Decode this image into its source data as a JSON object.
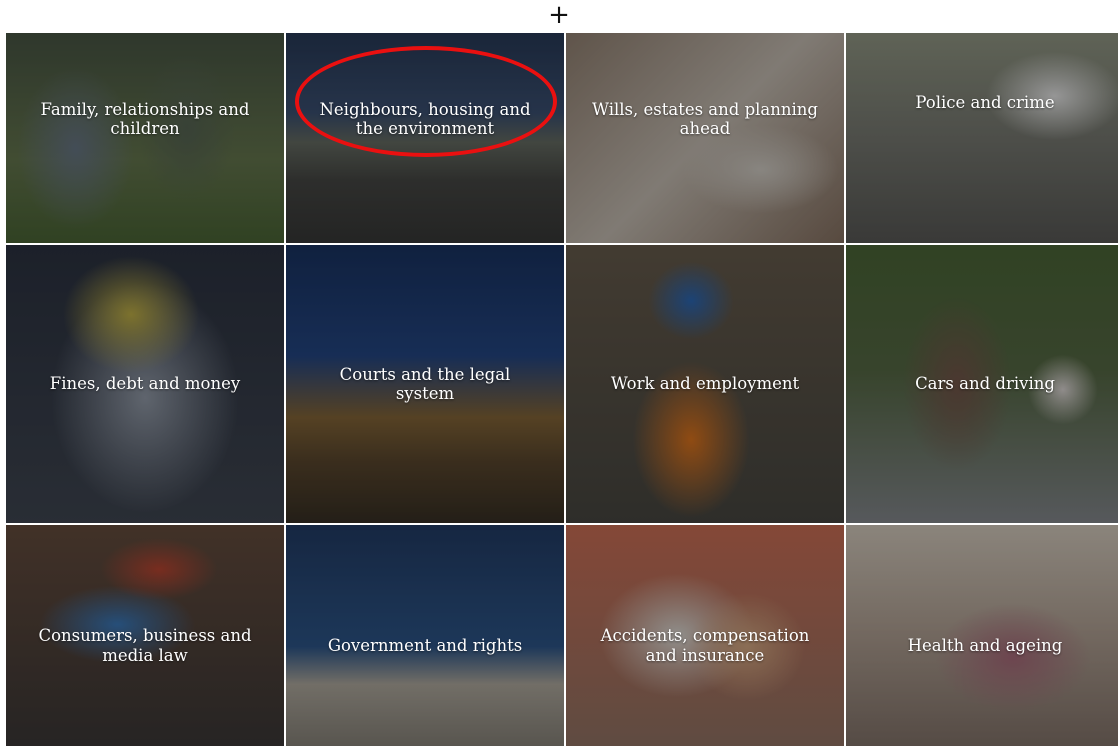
{
  "header": {
    "add_symbol": "+"
  },
  "categories": [
    {
      "label": "Family, relationships and children"
    },
    {
      "label": "Neighbours, housing and the environment"
    },
    {
      "label": "Wills, estates and planning ahead"
    },
    {
      "label": "Police and crime"
    },
    {
      "label": "Fines, debt and money"
    },
    {
      "label": "Courts and the legal system"
    },
    {
      "label": "Work and employment"
    },
    {
      "label": "Cars and driving"
    },
    {
      "label": "Consumers, business and media law"
    },
    {
      "label": "Government and rights"
    },
    {
      "label": "Accidents, compensation and insurance"
    },
    {
      "label": "Health and ageing"
    }
  ],
  "colors": {
    "annotation": "#ea1010",
    "label_text": "#ffffff"
  }
}
